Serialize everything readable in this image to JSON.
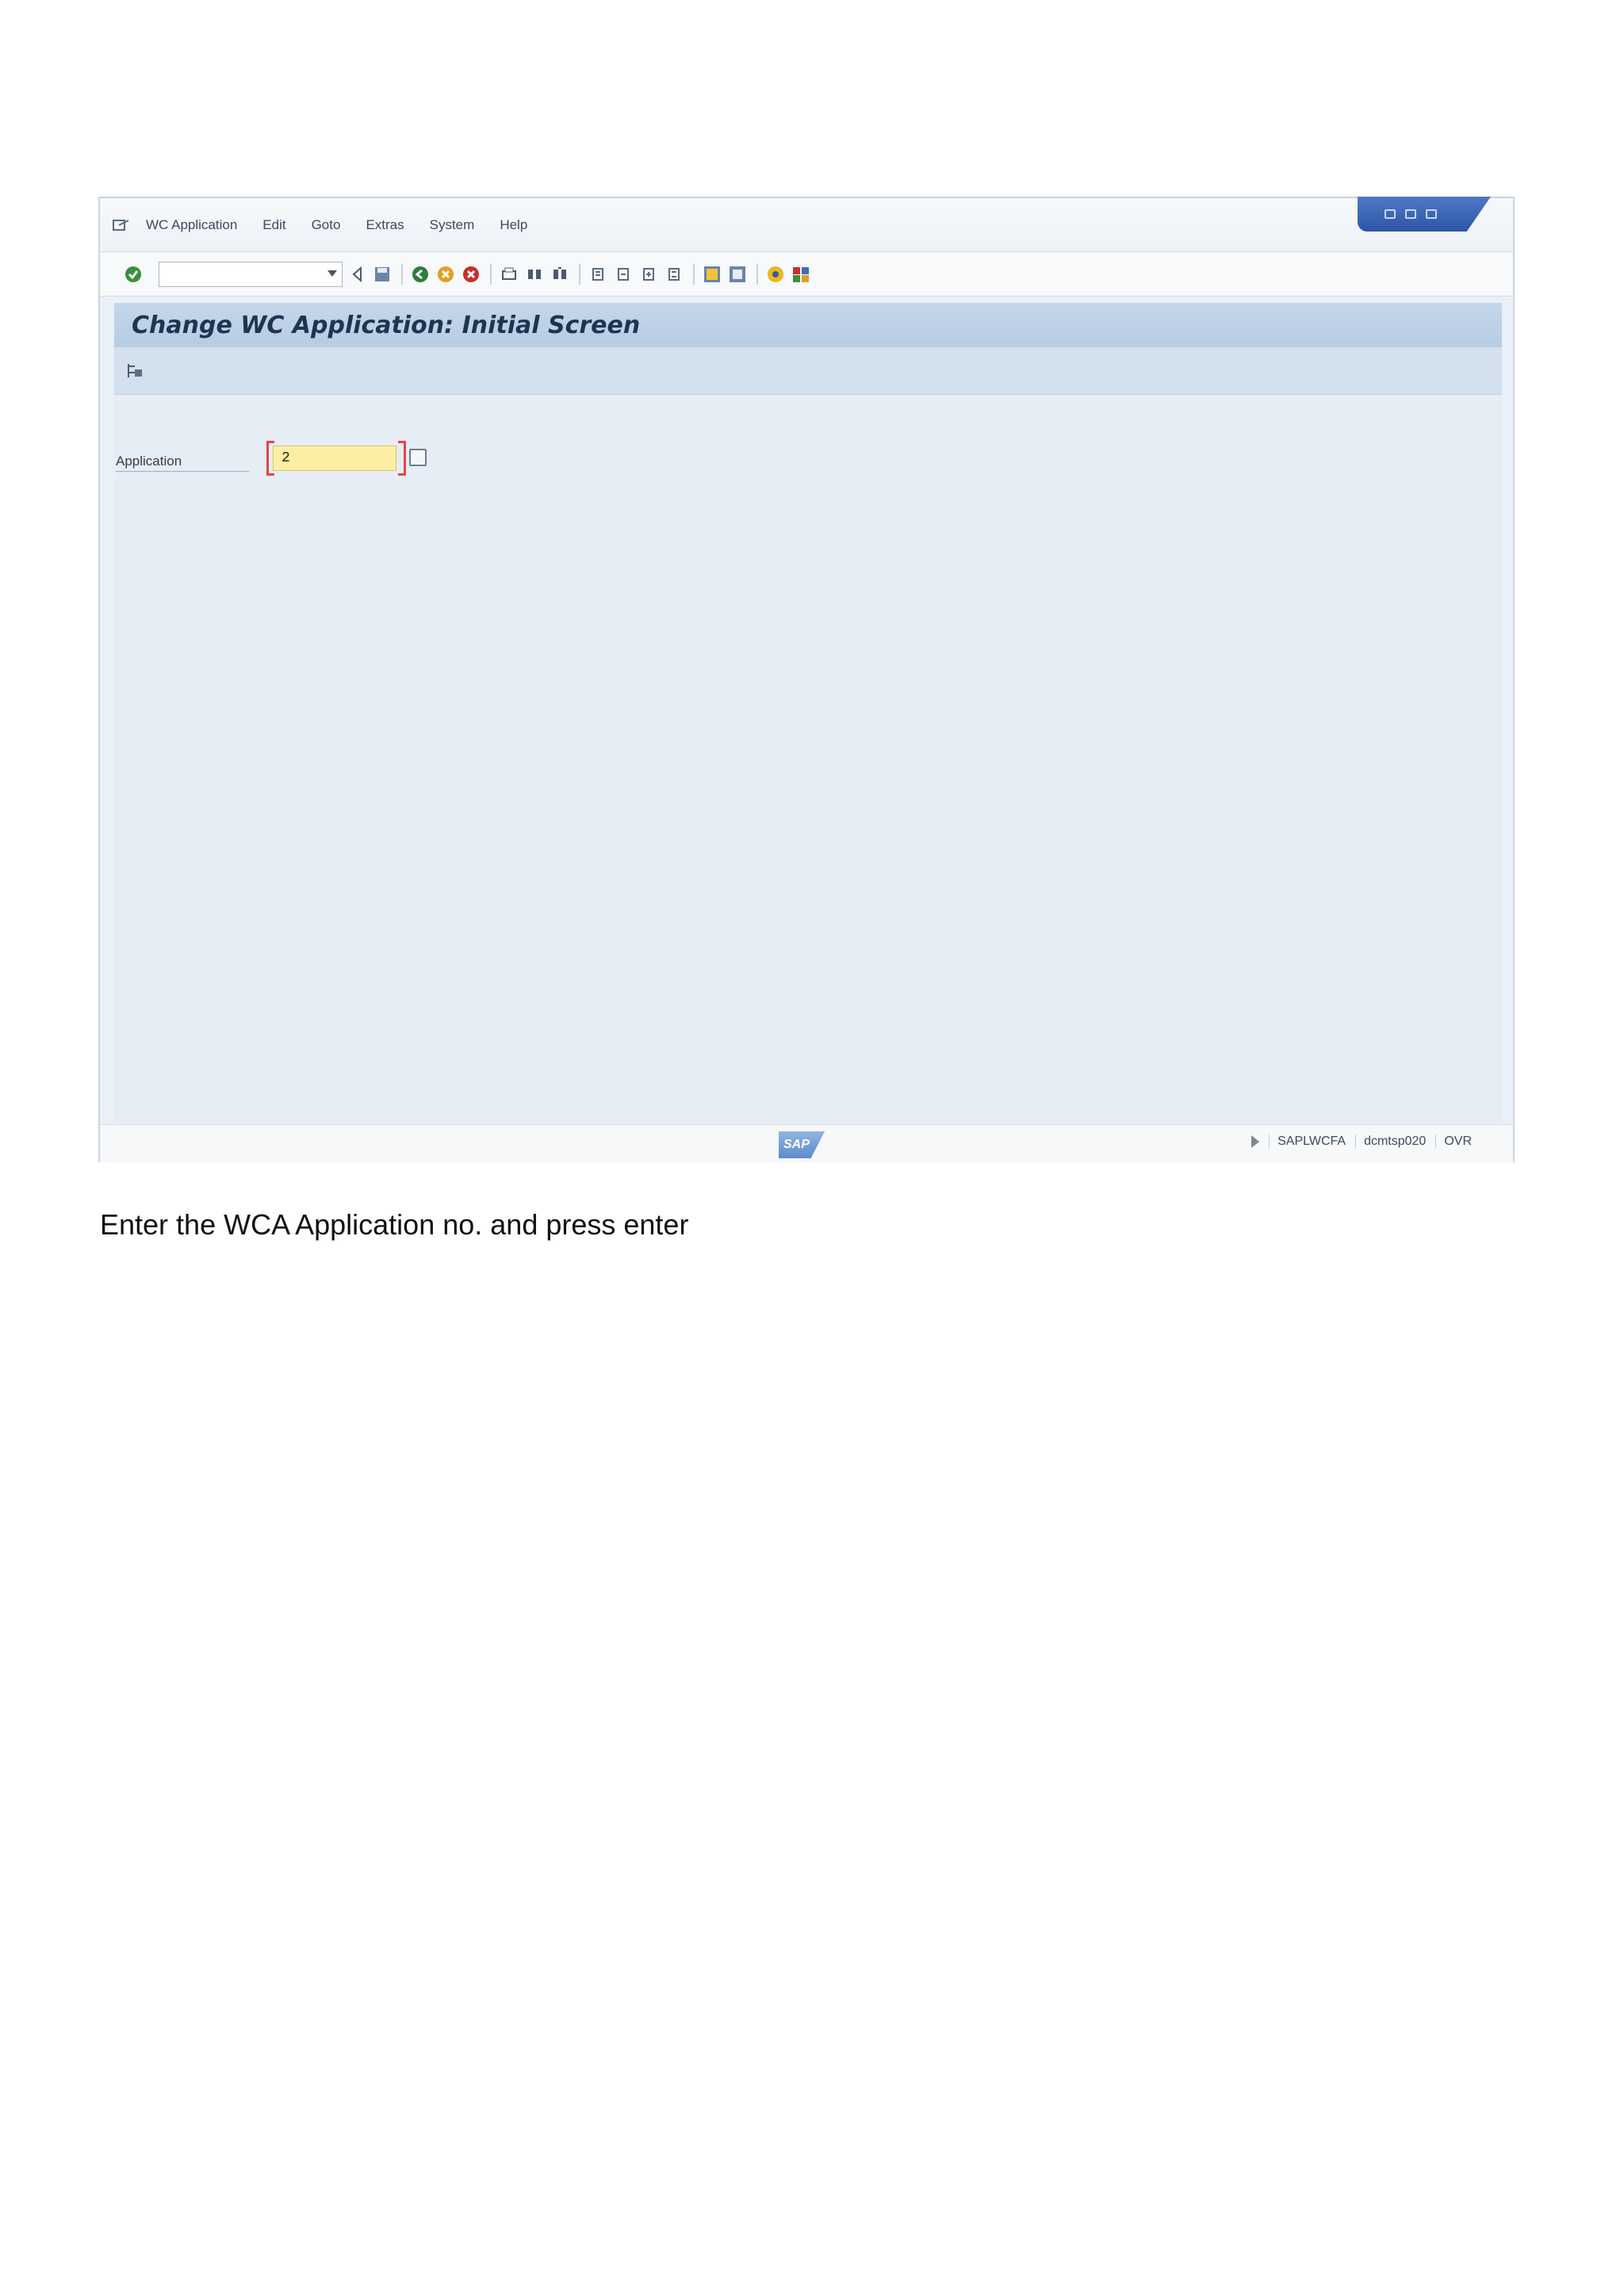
{
  "menubar": {
    "items": [
      "WC Application",
      "Edit",
      "Goto",
      "Extras",
      "System",
      "Help"
    ]
  },
  "toolbar": {
    "command_field_value": ""
  },
  "screen": {
    "title": "Change WC Application: Initial Screen"
  },
  "form": {
    "application_label": "Application",
    "application_value": "2"
  },
  "statusbar": {
    "logo_text": "SAP",
    "program": "SAPLWCFA",
    "server": "dcmtsp020",
    "mode": "OVR"
  },
  "caption": "Enter the WCA Application no. and press enter",
  "colors": {
    "title_bar": "#b7cbe2",
    "input_bg": "#fcefa3",
    "required_bracket": "#e04a3a",
    "window_controls": "#2d55a6"
  },
  "icons": [
    "menu-options-icon",
    "enter-check-icon",
    "back-icon",
    "save-icon",
    "back-nav-icon",
    "exit-icon",
    "cancel-icon",
    "print-icon",
    "find-icon",
    "find-next-icon",
    "first-page-icon",
    "previous-page-icon",
    "next-page-icon",
    "last-page-icon",
    "create-session-icon",
    "shortcut-icon",
    "help-icon",
    "customize-layout-icon",
    "other-object-icon"
  ]
}
